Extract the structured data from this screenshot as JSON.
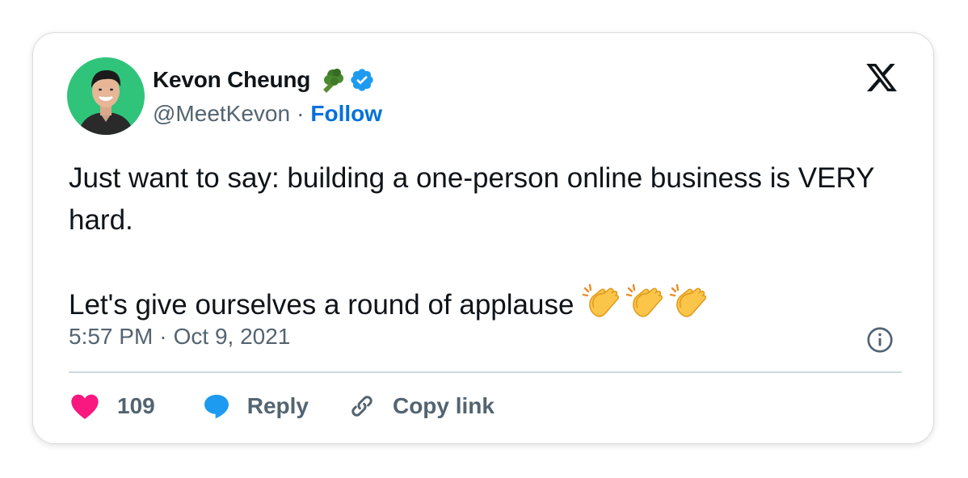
{
  "author": {
    "name": "Kevon Cheung",
    "handle": "@MeetKevon",
    "separator": "·",
    "follow_label": "Follow",
    "name_emoji": "broccoli-icon",
    "verified": "verified-badge-icon"
  },
  "tweet": {
    "text": "Just want to say: building a one-person online business is VERY hard.\n\nLet's give ourselves a round of applause",
    "trailing_emoji": [
      "clapping-hands-icon",
      "clapping-hands-icon",
      "clapping-hands-icon"
    ],
    "time": "5:57 PM",
    "date_separator": "·",
    "date": "Oct 9, 2021"
  },
  "actions": {
    "like_count": "109",
    "reply_label": "Reply",
    "copy_link_label": "Copy link"
  },
  "colors": {
    "follow": "#0071d9",
    "verified": "#1d9bf0",
    "like": "#f91880",
    "reply": "#1d9bf0",
    "secondary_text": "#536471",
    "avatar_bg": "#2fc47a"
  },
  "brand": {
    "logo": "x-logo-icon"
  }
}
